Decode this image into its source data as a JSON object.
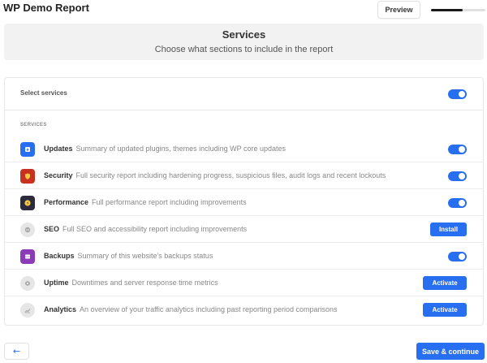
{
  "header": {
    "app_title": "WP Demo Report",
    "preview_label": "Preview",
    "progress_fraction": 0.58
  },
  "intro": {
    "title": "Services",
    "subtitle": "Choose what sections to include in the report"
  },
  "select_all": {
    "label": "Select services",
    "enabled": true
  },
  "section_label": "SERVICES",
  "services": [
    {
      "name": "Updates",
      "description": "Summary of updated plugins, themes including WP core updates",
      "icon": "updates-icon",
      "icon_color": "#286ef1",
      "control": "toggle",
      "enabled": true
    },
    {
      "name": "Security",
      "description": "Full security report including hardening progress, suspicious files, audit logs and recent lockouts",
      "icon": "security-icon",
      "icon_color": "#c8301f",
      "control": "toggle",
      "enabled": true
    },
    {
      "name": "Performance",
      "description": "Full performance report including improvements",
      "icon": "performance-icon",
      "icon_color": "#2b2b3c",
      "control": "toggle",
      "enabled": true
    },
    {
      "name": "SEO",
      "description": "Full SEO and accessibility report including improvements",
      "icon": "seo-icon",
      "icon_color": "#d9d9d9",
      "control": "button",
      "button_label": "Install"
    },
    {
      "name": "Backups",
      "description": "Summary of this website's backups status",
      "icon": "backups-icon",
      "icon_color": "#8a3bb5",
      "control": "toggle",
      "enabled": true
    },
    {
      "name": "Uptime",
      "description": "Downtimes and server response time metrics",
      "icon": "uptime-icon",
      "icon_color": "#d9d9d9",
      "control": "button",
      "button_label": "Activate"
    },
    {
      "name": "Analytics",
      "description": "An overview of your traffic analytics including past reporting period comparisons",
      "icon": "analytics-icon",
      "icon_color": "#d9d9d9",
      "control": "button",
      "button_label": "Activate"
    }
  ],
  "footer": {
    "back_label": "←",
    "save_label": "Save & continue"
  },
  "colors": {
    "accent": "#286ef1"
  }
}
